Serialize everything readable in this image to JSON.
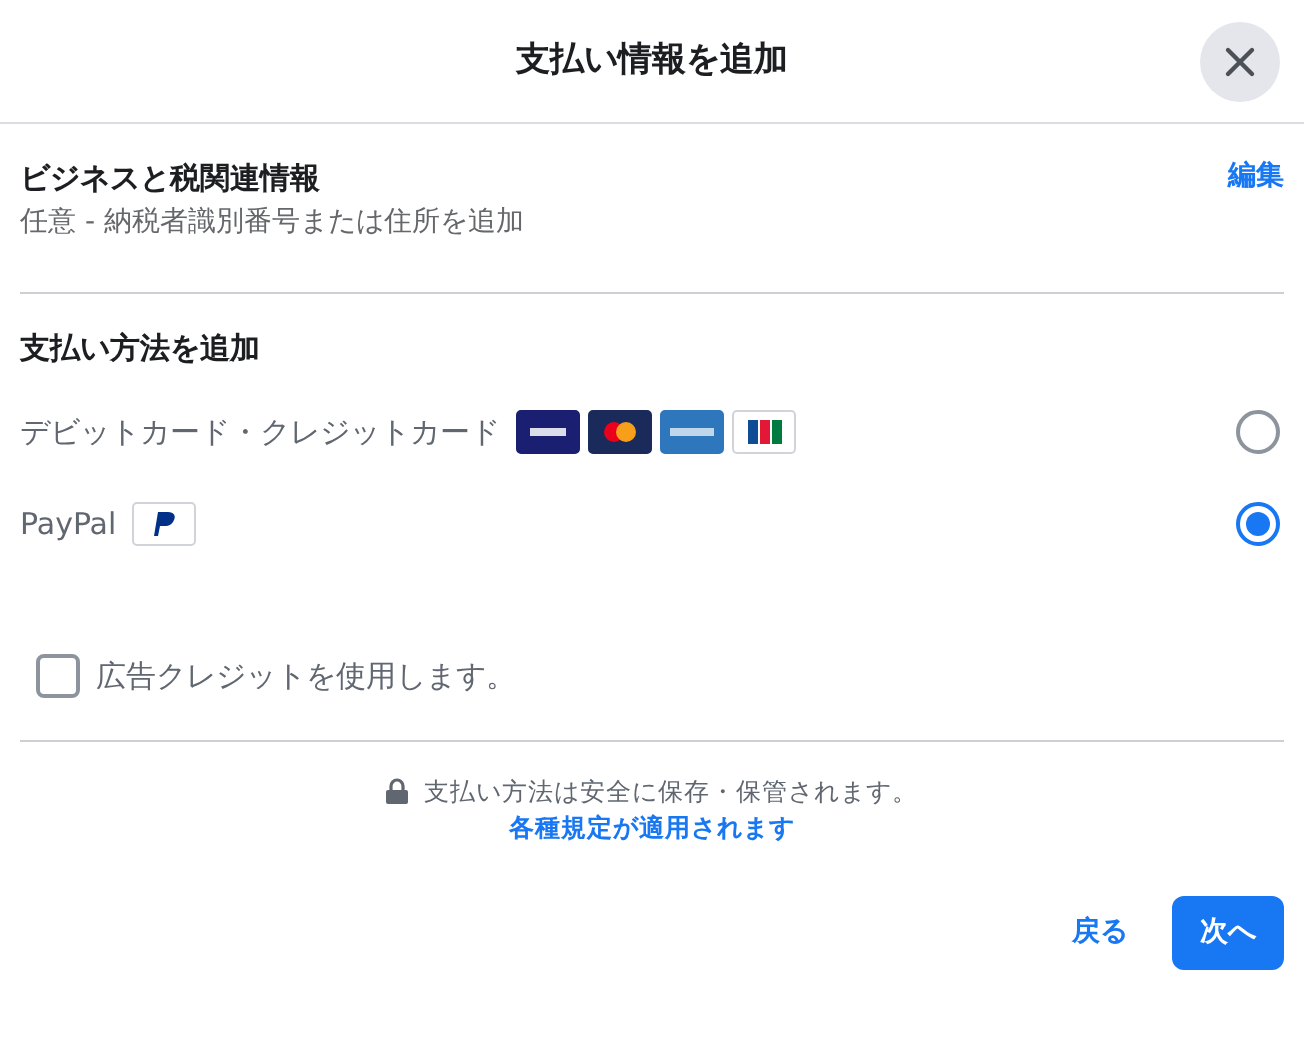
{
  "dialog": {
    "title": "支払い情報を追加"
  },
  "business_info": {
    "heading": "ビジネスと税関連情報",
    "subtitle": "任意 - 納税者識別番号または住所を追加",
    "edit_link": "編集"
  },
  "payment_section": {
    "heading": "支払い方法を追加",
    "methods": [
      {
        "label": "デビットカード・クレジットカード",
        "kind": "cards",
        "selected": false
      },
      {
        "label": "PayPal",
        "kind": "paypal",
        "selected": true
      }
    ]
  },
  "ad_credit": {
    "label": "広告クレジットを使用します。",
    "checked": false
  },
  "footer": {
    "security_note": "支払い方法は安全に保存・保管されます。",
    "terms_link": "各種規定が適用されます"
  },
  "buttons": {
    "back": "戻る",
    "next": "次へ"
  }
}
